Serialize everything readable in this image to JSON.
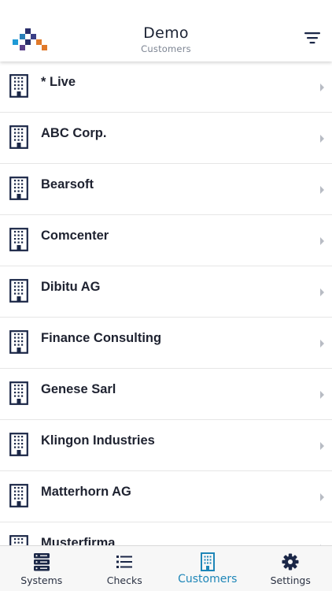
{
  "header": {
    "title": "Demo",
    "subtitle": "Customers",
    "logo_icon": "app-logo-icon",
    "filter_icon": "filter-icon"
  },
  "customers": [
    "* Live",
    "ABC Corp.",
    "Bearsoft",
    "Comcenter",
    "Dibitu AG",
    "Finance Consulting",
    "Genese Sarl",
    "Klingon Industries",
    "Matterhorn AG",
    "Musterfirma"
  ],
  "tabs": [
    {
      "label": "Systems",
      "icon": "server-icon",
      "active": false
    },
    {
      "label": "Checks",
      "icon": "list-icon",
      "active": false
    },
    {
      "label": "Customers",
      "icon": "building-icon",
      "active": true
    },
    {
      "label": "Settings",
      "icon": "gear-icon",
      "active": false
    }
  ],
  "colors": {
    "text_dark": "#1e2230",
    "icon_navy": "#1b2747",
    "accent": "#1e86b8",
    "divider": "#e6e6e6",
    "tabbar_bg": "#f7f7f7",
    "logo_blue": "#1e86b8",
    "logo_navy": "#2a2f6b",
    "logo_orange": "#e0792a"
  }
}
